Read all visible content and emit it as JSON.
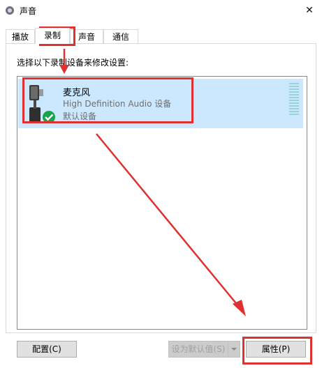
{
  "window": {
    "title": "声音",
    "close_glyph": "✕"
  },
  "tabs": [
    {
      "label": "播放",
      "active": false
    },
    {
      "label": "录制",
      "active": true
    },
    {
      "label": "声音",
      "active": false
    },
    {
      "label": "通信",
      "active": false
    }
  ],
  "instruction": "选择以下录制设备来修改设置:",
  "device": {
    "name": "麦克风",
    "description": "High Definition Audio 设备",
    "status": "默认设备",
    "icon": "microphone-icon",
    "badge": "default-check-icon"
  },
  "buttons": {
    "configure": "配置(C)",
    "set_default": "设为默认值(S)",
    "properties": "属性(P)"
  },
  "colors": {
    "highlight": "#e03131",
    "selection": "#cce8ff",
    "check": "#16a34a"
  }
}
